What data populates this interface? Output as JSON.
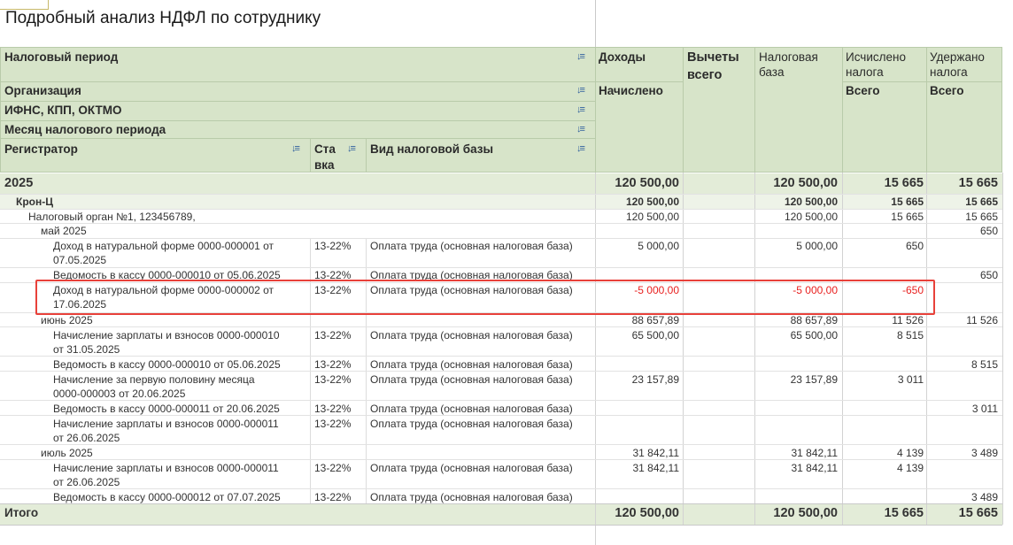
{
  "report_title": "Подробный анализ НДФЛ по сотруднику",
  "header": {
    "tax_period": "Налоговый период",
    "organization": "Организация",
    "ifns": "ИФНС, КПП, ОКТМО",
    "month": "Месяц налогового периода",
    "registrator": "Регистратор",
    "rate_1": "Ста",
    "rate_2": "вка",
    "base_type": "Вид налоговой базы",
    "income": "Доходы",
    "accrued": "Начислено",
    "deductions_1": "Вычеты",
    "deductions_2": "всего",
    "taxbase_1": "Налоговая",
    "taxbase_2": "база",
    "calc_1": "Исчислено",
    "calc_2": "налога",
    "calc_total": "Всего",
    "withheld_1": "Удержано",
    "withheld_2": "налога",
    "withheld_total": "Всего",
    "sort_icon": "sort-descending-icon"
  },
  "rows": {
    "r2025": {
      "label": "2025",
      "income": "120 500,00",
      "base": "120 500,00",
      "calc": "15 665",
      "withheld": "15 665"
    },
    "org": {
      "label": "Крон-Ц",
      "income": "120 500,00",
      "base": "120 500,00",
      "calc": "15 665",
      "withheld": "15 665"
    },
    "ifns": {
      "label": "Налоговый орган №1, 123456789,",
      "income": "120 500,00",
      "base": "120 500,00",
      "calc": "15 665",
      "withheld": "15 665"
    },
    "may": {
      "label": "май 2025",
      "withheld": "650"
    },
    "may1": {
      "reg1": "Доход в натуральной форме 0000-000001 от",
      "reg2": "07.05.2025",
      "rate": "13-22%",
      "kind": "Оплата труда (основная налоговая база)",
      "income": "5 000,00",
      "base": "5 000,00",
      "calc": "650"
    },
    "may2": {
      "reg1": "Ведомость в кассу 0000-000010 от 05.06.2025",
      "rate": "13-22%",
      "kind": "Оплата труда (основная налоговая база)",
      "withheld": "650"
    },
    "may3": {
      "reg1": "Доход в натуральной форме 0000-000002 от",
      "reg2": "17.06.2025",
      "rate": "13-22%",
      "kind": "Оплата труда (основная налоговая база)",
      "income": "-5 000,00",
      "base": "-5 000,00",
      "calc": "-650"
    },
    "june": {
      "label": "июнь 2025",
      "income": "88 657,89",
      "base": "88 657,89",
      "calc": "11 526",
      "withheld": "11 526"
    },
    "june1": {
      "reg1": "Начисление зарплаты и взносов 0000-000010",
      "reg2": "от 31.05.2025",
      "rate": "13-22%",
      "kind": "Оплата труда (основная налоговая база)",
      "income": "65 500,00",
      "base": "65 500,00",
      "calc": "8 515"
    },
    "june2": {
      "reg1": "Ведомость в кассу 0000-000010 от 05.06.2025",
      "rate": "13-22%",
      "kind": "Оплата труда (основная налоговая база)",
      "withheld": "8 515"
    },
    "june3": {
      "reg1": "Начисление за первую половину месяца",
      "reg2": "0000-000003 от 20.06.2025",
      "rate": "13-22%",
      "kind": "Оплата труда (основная налоговая база)",
      "income": "23 157,89",
      "base": "23 157,89",
      "calc": "3 011"
    },
    "june4": {
      "reg1": "Ведомость в кассу 0000-000011 от 20.06.2025",
      "rate": "13-22%",
      "kind": "Оплата труда (основная налоговая база)",
      "withheld": "3 011"
    },
    "june5": {
      "reg1": "Начисление зарплаты и взносов 0000-000011",
      "reg2": "от 26.06.2025",
      "rate": "13-22%",
      "kind": "Оплата труда (основная налоговая база)"
    },
    "july": {
      "label": "июль 2025",
      "income": "31 842,11",
      "base": "31 842,11",
      "calc": "4 139",
      "withheld": "3 489"
    },
    "july1": {
      "reg1": "Начисление зарплаты и взносов 0000-000011",
      "reg2": "от 26.06.2025",
      "rate": "13-22%",
      "kind": "Оплата труда (основная налоговая база)",
      "income": "31 842,11",
      "base": "31 842,11",
      "calc": "4 139"
    },
    "july2": {
      "reg1": "Ведомость в кассу 0000-000012 от 07.07.2025",
      "rate": "13-22%",
      "kind": "Оплата труда (основная налоговая база)",
      "withheld": "3 489"
    },
    "total": {
      "label": "Итого",
      "income": "120 500,00",
      "base": "120 500,00",
      "calc": "15 665",
      "withheld": "15 665"
    }
  },
  "colors": {
    "header_bg": "#d7e4c9",
    "negative": "#e8201f",
    "highlight": "#e8413a"
  }
}
